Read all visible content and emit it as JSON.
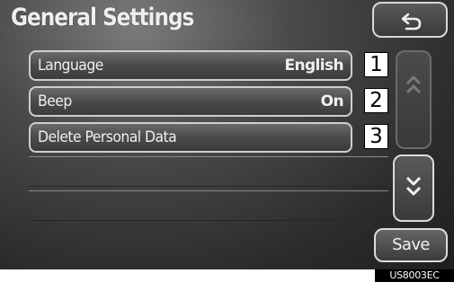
{
  "header": {
    "title": "General Settings"
  },
  "items": [
    {
      "label": "Language",
      "value": "English",
      "callout": "1"
    },
    {
      "label": "Beep",
      "value": "On",
      "callout": "2"
    },
    {
      "label": "Delete Personal Data",
      "value": "",
      "callout": "3"
    }
  ],
  "footer": {
    "save_label": "Save",
    "image_code": "US8003EC"
  },
  "icons": {
    "back": "back-arrow-icon",
    "scroll_up": "double-chevron-up-icon",
    "scroll_down": "double-chevron-down-icon"
  },
  "colors": {
    "background": "#3a3a3a",
    "text": "#f0f0f0",
    "border": "#cfcfcf"
  }
}
